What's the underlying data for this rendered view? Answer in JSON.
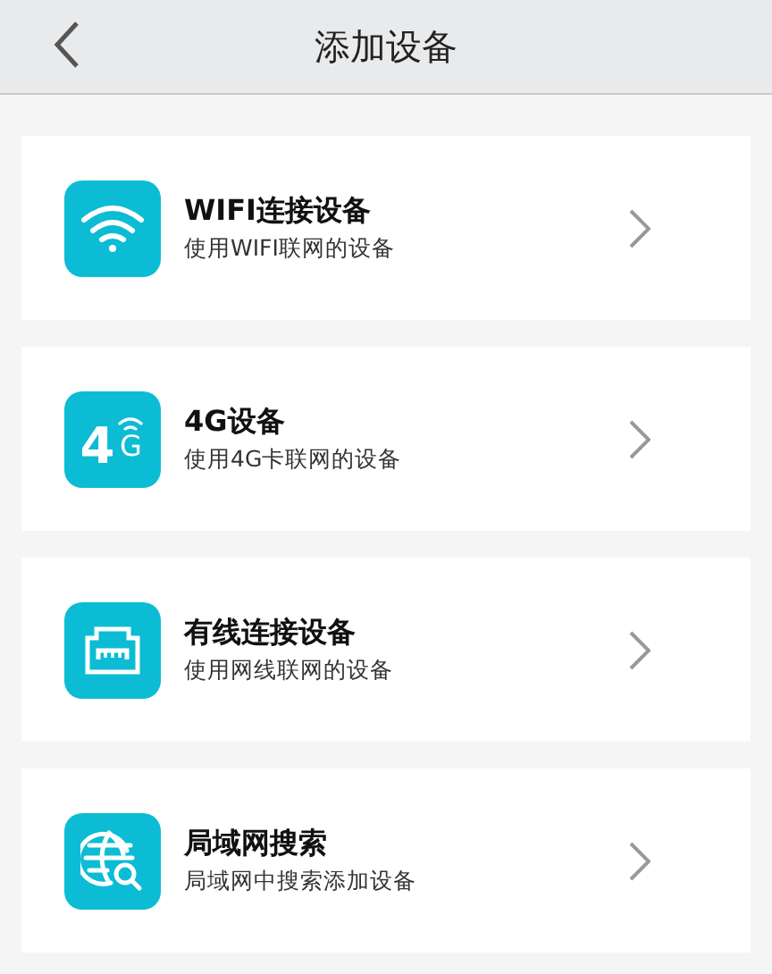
{
  "header": {
    "title": "添加设备"
  },
  "items": [
    {
      "kind": "wifi",
      "title": "WIFI连接设备",
      "subtitle": "使用WIFI联网的设备"
    },
    {
      "kind": "cellular",
      "title": "4G设备",
      "subtitle": "使用4G卡联网的设备",
      "icon_text": [
        "4",
        "G"
      ]
    },
    {
      "kind": "ethernet",
      "title": "有线连接设备",
      "subtitle": "使用网线联网的设备"
    },
    {
      "kind": "search",
      "title": "局域网搜索",
      "subtitle": "局域网中搜索添加设备"
    }
  ]
}
